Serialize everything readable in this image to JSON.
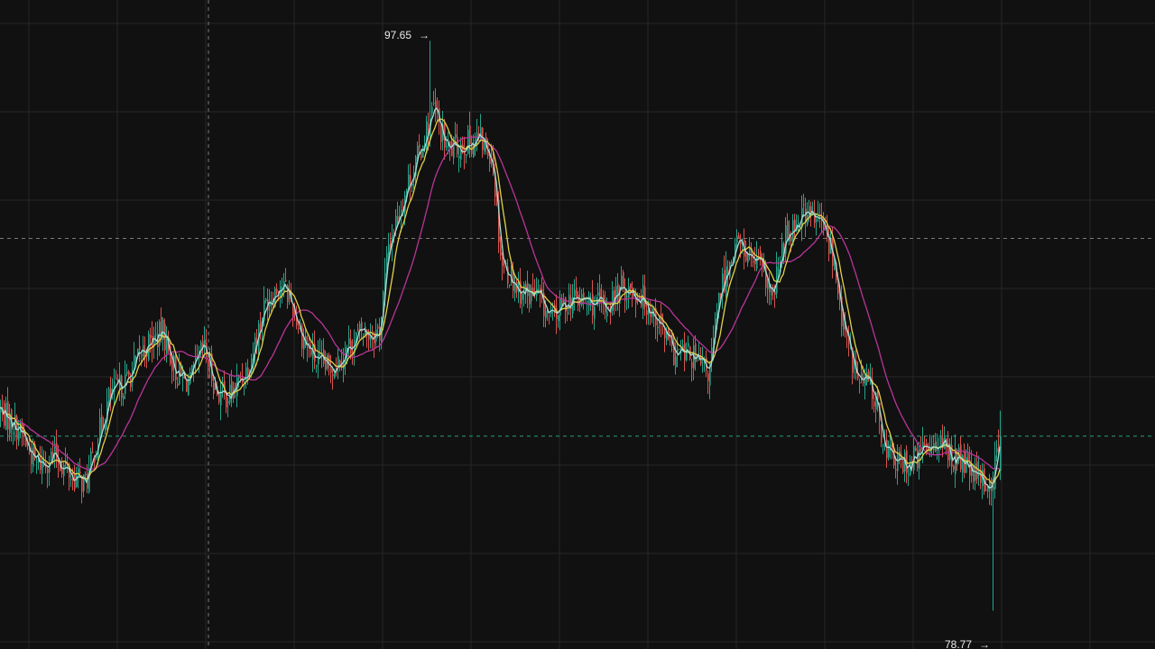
{
  "legend": {
    "ma_fast": {
      "label": "",
      "color": "#e3d247"
    },
    "ma_slow": {
      "label": "",
      "color": "#b8359a"
    },
    "ma_short": {
      "label": "",
      "color": "#a7ddd4"
    }
  },
  "colors": {
    "background": "#111111",
    "grid": "#262626",
    "up": "#26a48a",
    "down": "#d9534f",
    "crosshair": "#7a7a7a",
    "price_line": "#2f9c84",
    "ma_short": "#a7ddd4",
    "ma_fast": "#e3d247",
    "ma_slow": "#b8359a",
    "label_text": "#e8e8e8"
  },
  "chart_data": {
    "type": "candlestick",
    "title": "",
    "grid": true,
    "ylim": [
      77.5,
      99.0
    ],
    "high_marker": {
      "label": "97.65",
      "arrow": "→",
      "value": 97.65
    },
    "low_marker": {
      "label": "78.77",
      "arrow": "→",
      "value": 78.77
    },
    "current_price": 84.55,
    "horizontal_reference": 91.1,
    "anchors": [
      [
        0,
        85.4
      ],
      [
        20,
        84.8
      ],
      [
        40,
        83.6
      ],
      [
        60,
        83.9
      ],
      [
        80,
        83.2
      ],
      [
        95,
        83.0
      ],
      [
        105,
        84.2
      ],
      [
        120,
        85.8
      ],
      [
        140,
        86.4
      ],
      [
        160,
        87.5
      ],
      [
        180,
        88.0
      ],
      [
        195,
        86.6
      ],
      [
        210,
        86.3
      ],
      [
        225,
        87.5
      ],
      [
        240,
        86.0
      ],
      [
        255,
        85.9
      ],
      [
        275,
        86.9
      ],
      [
        295,
        89.1
      ],
      [
        310,
        89.6
      ],
      [
        320,
        89.2
      ],
      [
        335,
        87.8
      ],
      [
        350,
        87.0
      ],
      [
        365,
        86.8
      ],
      [
        380,
        87.3
      ],
      [
        400,
        88.0
      ],
      [
        420,
        88.0
      ],
      [
        430,
        90.9
      ],
      [
        450,
        92.8
      ],
      [
        465,
        94.0
      ],
      [
        480,
        95.4
      ],
      [
        495,
        94.0
      ],
      [
        510,
        94.2
      ],
      [
        530,
        94.4
      ],
      [
        545,
        93.9
      ],
      [
        555,
        90.3
      ],
      [
        575,
        89.4
      ],
      [
        595,
        89.2
      ],
      [
        610,
        88.4
      ],
      [
        630,
        89.1
      ],
      [
        650,
        89.0
      ],
      [
        670,
        88.8
      ],
      [
        690,
        89.5
      ],
      [
        710,
        89.2
      ],
      [
        725,
        88.6
      ],
      [
        745,
        87.3
      ],
      [
        765,
        87.2
      ],
      [
        785,
        86.6
      ],
      [
        798,
        89.4
      ],
      [
        815,
        91.0
      ],
      [
        830,
        90.5
      ],
      [
        845,
        90.0
      ],
      [
        855,
        89.0
      ],
      [
        870,
        91.2
      ],
      [
        890,
        92.0
      ],
      [
        910,
        91.6
      ],
      [
        920,
        90.8
      ],
      [
        935,
        88.0
      ],
      [
        950,
        86.4
      ],
      [
        965,
        86.3
      ],
      [
        980,
        84.2
      ],
      [
        995,
        83.6
      ],
      [
        1015,
        83.8
      ],
      [
        1035,
        84.5
      ],
      [
        1050,
        84.0
      ],
      [
        1065,
        83.7
      ],
      [
        1080,
        83.2
      ],
      [
        1098,
        82.9
      ],
      [
        1108,
        84.55
      ]
    ]
  }
}
